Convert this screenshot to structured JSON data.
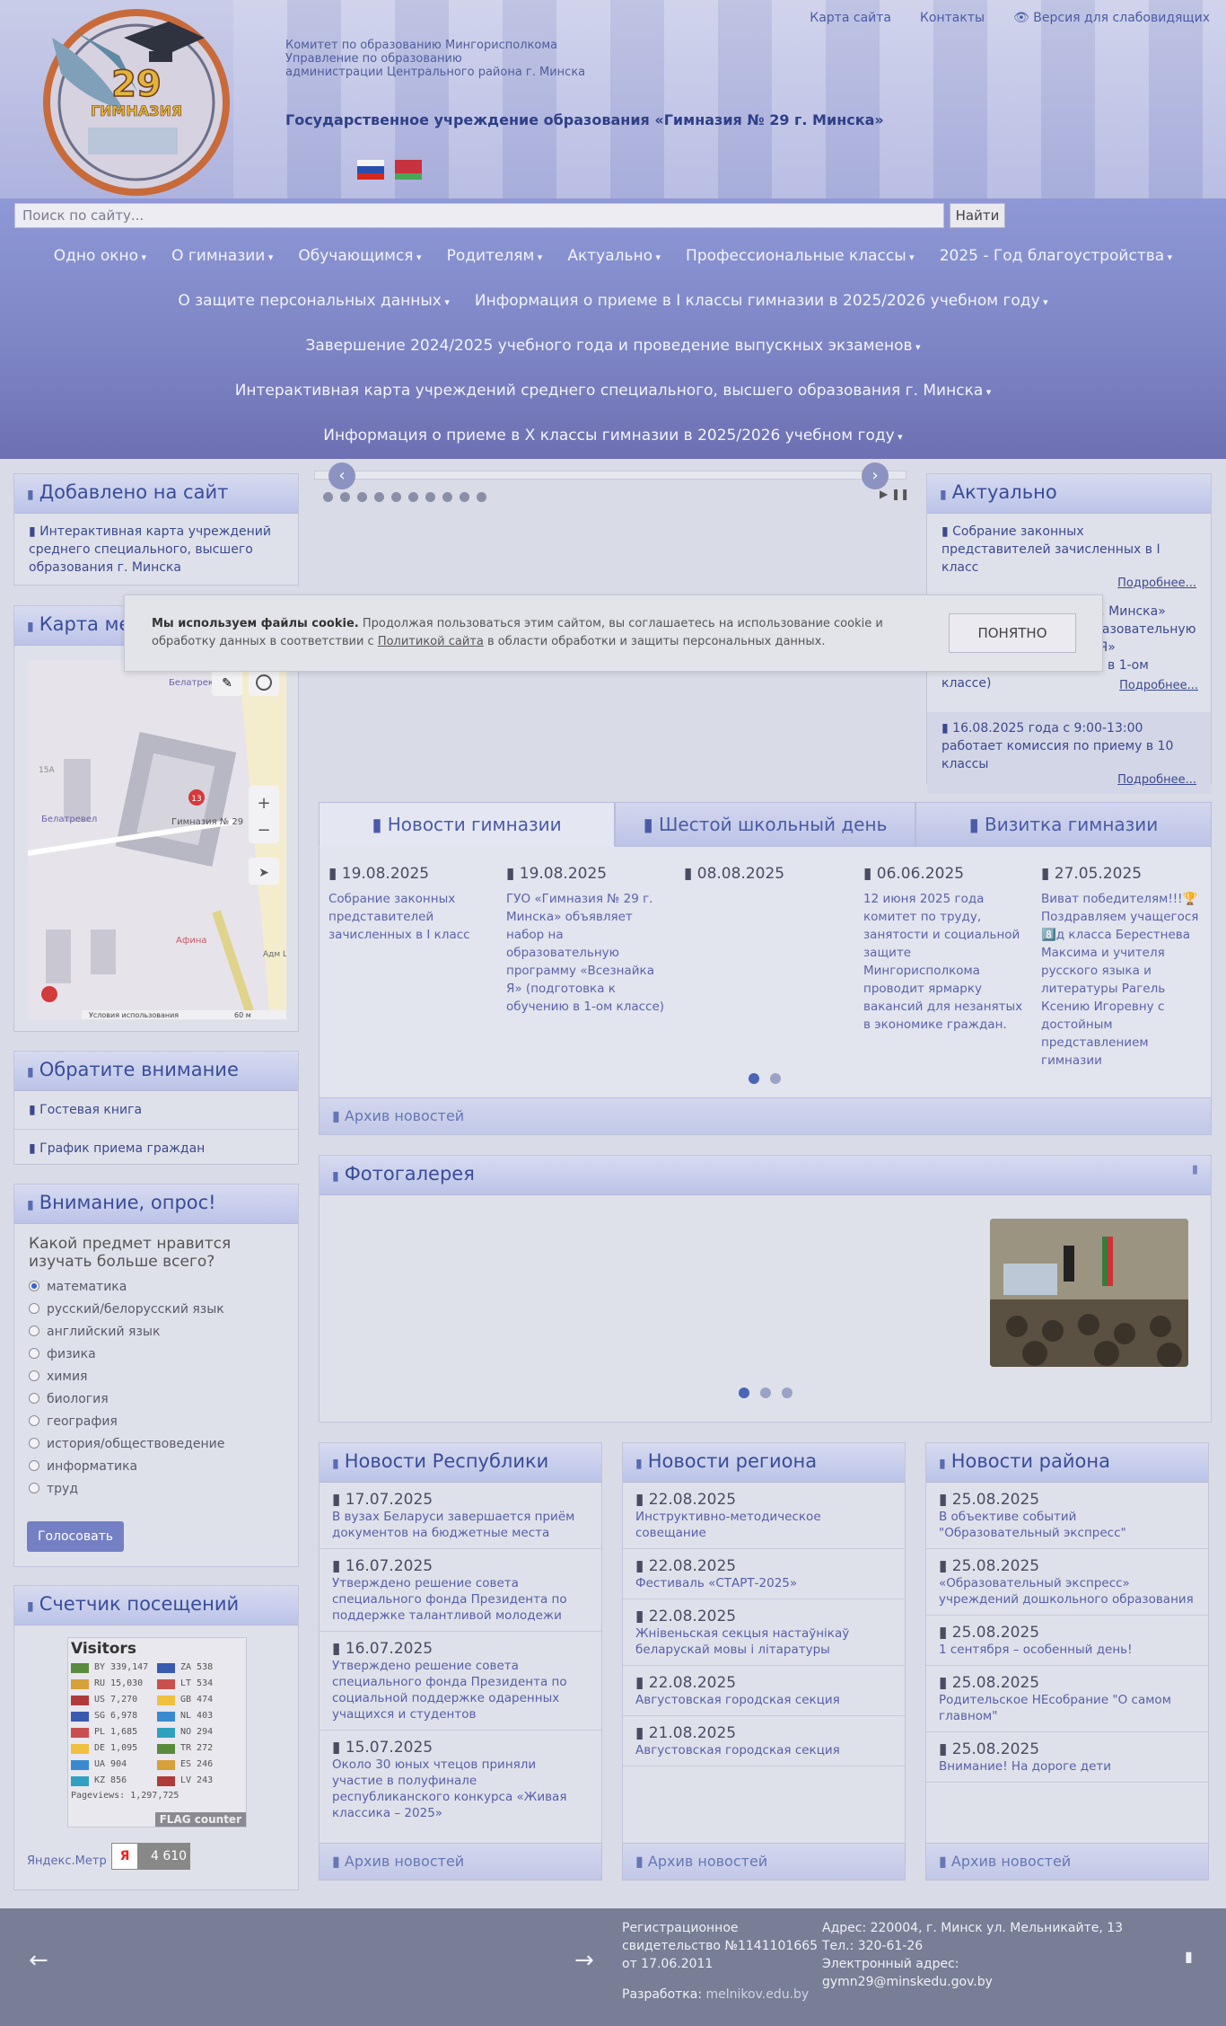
{
  "header": {
    "top_links": [
      "Карта сайта",
      "Контакты",
      "Версия для слабовидящих"
    ],
    "org_lines": [
      "Комитет по образованию Мингорисполкома",
      "Управление по образованию",
      "администрации Центрального района г. Минска"
    ],
    "title": "Государственное учреждение образования «Гимназия № 29 г. Минска»",
    "logo_number": "29",
    "logo_word": "ГИМНАЗИЯ"
  },
  "search": {
    "placeholder": "Поиск по сайту...",
    "button": "Найти"
  },
  "menu": {
    "row1": [
      "Одно окно",
      "О гимназии",
      "Обучающимся",
      "Родителям",
      "Актуально",
      "Профессиональные классы",
      "2025 - Год благоустройства"
    ],
    "row2": [
      "О защите персональных данных",
      "Информация о приеме в I классы гимназии в 2025/2026 учебном году"
    ],
    "row3": "Завершение 2024/2025 учебного года и проведение выпускных экзаменов",
    "row4": "Интерактивная карта учреждений среднего специального, высшего образования г. Минска",
    "row5": "Информация о приеме в X классы гимназии в 2025/2026 учебном году"
  },
  "added": {
    "title": "Добавлено на сайт",
    "item": "Интерактивная карта учреждений среднего специального, высшего образования г. Минска"
  },
  "map": {
    "title": "Карта места",
    "labels": [
      "Белатрек",
      "Гимназия № 29",
      "Белатревел",
      "Афина",
      "15А",
      "Адм Цен"
    ],
    "terms": "Условия использования",
    "scale": "60 м"
  },
  "attention": {
    "title": "Обратите внимание",
    "items": [
      "Гостевая книга",
      "График приема граждан"
    ]
  },
  "poll": {
    "title": "Внимание, опрос!",
    "question": "Какой предмет нравится изучать больше всего?",
    "options": [
      "математика",
      "русский/белорусский язык",
      "английский язык",
      "физика",
      "химия",
      "биология",
      "география",
      "история/обществоведение",
      "информатика",
      "труд"
    ],
    "selected": 0,
    "button": "Голосовать"
  },
  "visits": {
    "title": "Счетчик посещений",
    "counter_title": "Visitors",
    "rows": [
      [
        "BY",
        "339,147",
        "ZA",
        "538"
      ],
      [
        "RU",
        "15,030",
        "LT",
        "534"
      ],
      [
        "US",
        "7,270",
        "GB",
        "474"
      ],
      [
        "SG",
        "6,978",
        "NL",
        "403"
      ],
      [
        "PL",
        "1,685",
        "NO",
        "294"
      ],
      [
        "DE",
        "1,095",
        "TR",
        "272"
      ],
      [
        "UA",
        "904",
        "ES",
        "246"
      ],
      [
        "KZ",
        "856",
        "LV",
        "243"
      ]
    ],
    "pageviews": "Pageviews: 1,297,725",
    "brand": "FLAG counter",
    "metrica": "Яндекс.Метр",
    "ya_count": "4 610"
  },
  "actual": {
    "title": "Актуально",
    "items": [
      "Собрание законных представителей зачисленных в I класс",
      "ГУО «Гимназия № 29 г. Минска» объявляет набор на образовательную программу «Всезнайка Я» (подготовка к обучению в 1-ом классе)",
      "16.08.2025 года с 9:00-13:00 работает комиссия по приему в 10 классы"
    ],
    "more": "Подробнее..."
  },
  "cookie": {
    "bold": "Мы используем файлы cookie.",
    "text": " Продолжая пользоваться этим сайтом, вы соглашаетесь на использование cookie и обработку данных в соответствии с ",
    "link": "Политикой сайта",
    "tail": " в области обработки и защиты персональных данных.",
    "button": "ПОНЯТНО"
  },
  "tabs": [
    "Новости гимназии",
    "Шестой школьный день",
    "Визитка гимназии"
  ],
  "news": [
    {
      "date": "19.08.2025",
      "text": "Собрание законных представителей зачисленных в I класс"
    },
    {
      "date": "19.08.2025",
      "text": "ГУО «Гимназия № 29 г. Минска» объявляет набор на образовательную программу «Всезнайка Я» (подготовка к обучению в 1-ом классе)"
    },
    {
      "date": "08.08.2025",
      "text": ""
    },
    {
      "date": "06.06.2025",
      "text": "12 июня 2025 года комитет по труду, занятости и социальной защите Мингорисполкома проводит ярмарку вакансий для незанятых в экономике граждан."
    },
    {
      "date": "27.05.2025",
      "text": "Виват победителям!!!🏆 Поздравляем учащегося 8️⃣д класса Берестнева Максима и учителя русского языка и литературы Рагель Ксению Игоревну с достойным представлением гимназии"
    }
  ],
  "archive": "Архив новостей",
  "gallery": {
    "title": "Фотогалерея"
  },
  "rep": {
    "title": "Новости Республики",
    "items": [
      {
        "date": "17.07.2025",
        "text": "В вузах Беларуси завершается приём документов на бюджетные места"
      },
      {
        "date": "16.07.2025",
        "text": "Утверждено решение совета специального фонда Президента по поддержке талантливой молодежи"
      },
      {
        "date": "16.07.2025",
        "text": "Утверждено решение совета специального фонда Президента по социальной поддержке одаренных учащихся и студентов"
      },
      {
        "date": "15.07.2025",
        "text": "Около 30 юных чтецов приняли участие в полуфинале республиканского конкурса «Живая классика – 2025»"
      }
    ]
  },
  "reg": {
    "title": "Новости региона",
    "items": [
      {
        "date": "22.08.2025",
        "text": "Инструктивно-методическое совещание"
      },
      {
        "date": "22.08.2025",
        "text": "Фестиваль «СТАРТ-2025»"
      },
      {
        "date": "22.08.2025",
        "text": "Жнівеньская секцыя настаўнікаў беларускай мовы і літаратуры"
      },
      {
        "date": "22.08.2025",
        "text": "Августовская городская секция"
      },
      {
        "date": "21.08.2025",
        "text": "Августовская городская секция"
      }
    ]
  },
  "dist": {
    "title": "Новости района",
    "items": [
      {
        "date": "25.08.2025",
        "text": "В объективе событий \"Образовательный экспресс\""
      },
      {
        "date": "25.08.2025",
        "text": "«Образовательный экспресс» учреждений дошкольного образования"
      },
      {
        "date": "25.08.2025",
        "text": "1 сентября – особенный день!"
      },
      {
        "date": "25.08.2025",
        "text": "Родительское НЕсобрание \"О самом главном\""
      },
      {
        "date": "25.08.2025",
        "text": "Внимание! На дороге дети"
      }
    ]
  },
  "footer": {
    "reg": [
      "Регистрационное",
      "свидетельство №1141101665",
      "от 17.06.2011"
    ],
    "dev_label": "Разработка:",
    "dev": "melnikov.edu.by",
    "addr": [
      "Адрес: 220004, г. Минск ул. Мельникайте, 13",
      "Тел.: 320-61-26",
      "Электронный адрес:",
      "gymn29@minskedu.gov.by"
    ]
  }
}
